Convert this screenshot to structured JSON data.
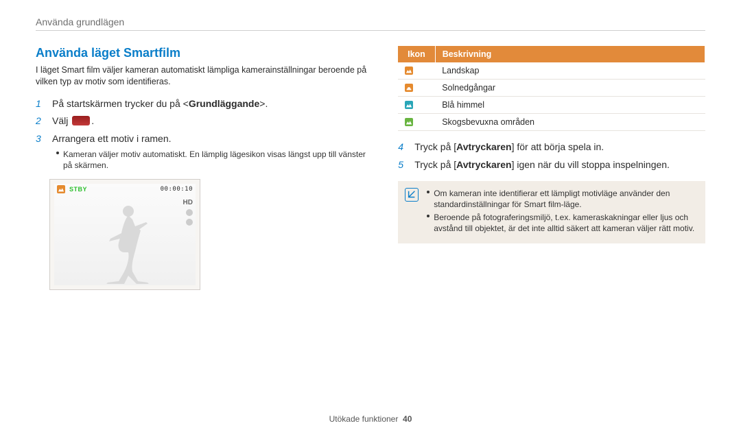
{
  "breadcrumb": "Använda grundlägen",
  "heading": "Använda läget Smartfilm",
  "intro": "I läget Smart film väljer kameran automatiskt lämpliga kamerainställningar beroende på vilken typ av motiv som identifieras.",
  "step1_num": "1",
  "step1_a": "På startskärmen trycker du på <",
  "step1_em": "Grundläggande",
  "step1_b": ">.",
  "step2_num": "2",
  "step2_txt": "Välj ",
  "step2_suffix": ".",
  "step3_num": "3",
  "step3_txt": "Arrangera ett motiv i ramen.",
  "step3_sub": "Kameran väljer motiv automatiskt. En lämplig lägesikon visas längst upp till vänster på skärmen.",
  "lcd_status": "STBY",
  "lcd_timecode": "00:00:10",
  "lcd_hd": "HD",
  "table_h1": "Ikon",
  "table_h2": "Beskrivning",
  "rows": {
    "r0": "Landskap",
    "r1": "Solnedgångar",
    "r2": "Blå himmel",
    "r3": "Skogsbevuxna områden"
  },
  "step4_num": "4",
  "step4_a": "Tryck på [",
  "step4_em": "Avtryckaren",
  "step4_b": "] för att börja spela in.",
  "step5_num": "5",
  "step5_a": "Tryck på [",
  "step5_em": "Avtryckaren",
  "step5_b": "] igen när du vill stoppa inspelningen.",
  "note1": "Om kameran inte identifierar ett lämpligt motivläge använder den standardinställningar för Smart film-läge.",
  "note2": "Beroende på fotograferingsmiljö, t.ex. kameraskakningar eller ljus och avstånd till objektet, är det inte alltid säkert att kameran väljer rätt motiv.",
  "footer_label": "Utökade funktioner",
  "footer_page": "40"
}
